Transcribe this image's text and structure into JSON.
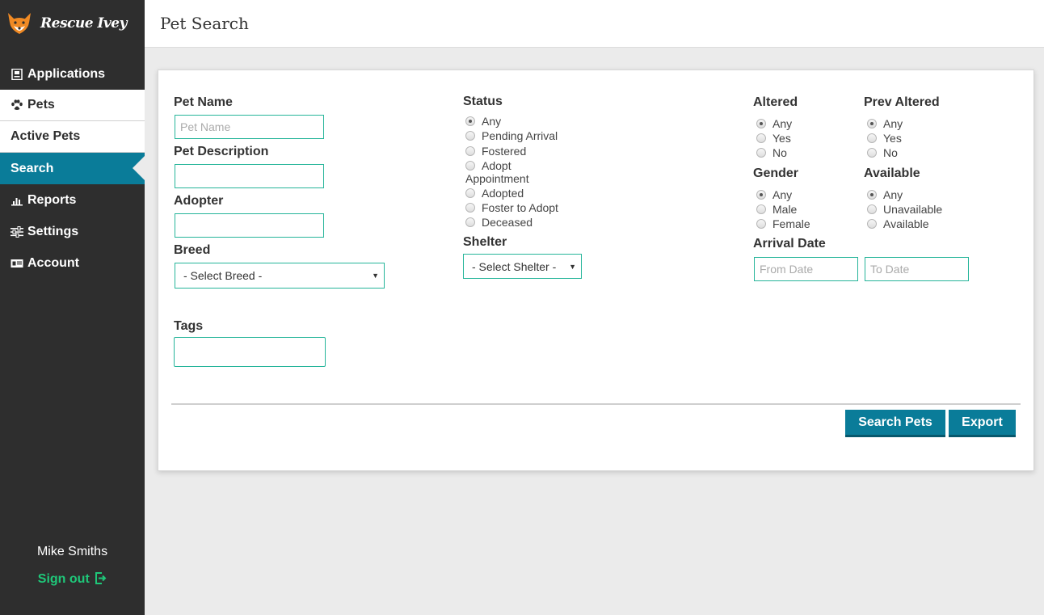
{
  "brand": {
    "name": "Rescue Ivey"
  },
  "nav": {
    "applications": "Applications",
    "pets": "Pets",
    "active_pets": "Active Pets",
    "search": "Search",
    "reports": "Reports",
    "settings": "Settings",
    "account": "Account"
  },
  "user": {
    "name": "Mike Smiths",
    "signout": "Sign out"
  },
  "header": {
    "title": "Pet Search"
  },
  "form": {
    "pet_name": {
      "label": "Pet Name",
      "placeholder": "Pet Name",
      "value": ""
    },
    "pet_description": {
      "label": "Pet Description",
      "value": ""
    },
    "adopter": {
      "label": "Adopter",
      "value": ""
    },
    "breed": {
      "label": "Breed",
      "selected": "- Select Breed -"
    },
    "tags": {
      "label": "Tags",
      "value": ""
    },
    "status": {
      "label": "Status",
      "options": [
        "Any",
        "Pending Arrival",
        "Fostered",
        "Adopt",
        "Appointment",
        "Adopted",
        "Foster to Adopt",
        "Deceased"
      ],
      "selected": "Any"
    },
    "shelter": {
      "label": "Shelter",
      "selected": "- Select Shelter -"
    },
    "altered": {
      "label": "Altered",
      "options": [
        "Any",
        "Yes",
        "No"
      ],
      "selected": "Any"
    },
    "prev_altered": {
      "label": "Prev Altered",
      "options": [
        "Any",
        "Yes",
        "No"
      ],
      "selected": "Any"
    },
    "gender": {
      "label": "Gender",
      "options": [
        "Any",
        "Male",
        "Female"
      ],
      "selected": "Any"
    },
    "available": {
      "label": "Available",
      "options": [
        "Any",
        "Unavailable",
        "Available"
      ],
      "selected": "Any"
    },
    "arrival_date": {
      "label": "Arrival Date",
      "from_placeholder": "From Date",
      "to_placeholder": "To Date"
    }
  },
  "actions": {
    "search": "Search Pets",
    "export": "Export"
  },
  "colors": {
    "sidebar": "#2e2e2e",
    "accent": "#0a7c99",
    "field_border": "#26b59a",
    "signout": "#1fc779"
  },
  "icons": [
    "fox-logo-icon",
    "document-icon",
    "paw-icon",
    "bar-chart-icon",
    "sliders-icon",
    "id-card-icon",
    "sign-out-icon"
  ]
}
